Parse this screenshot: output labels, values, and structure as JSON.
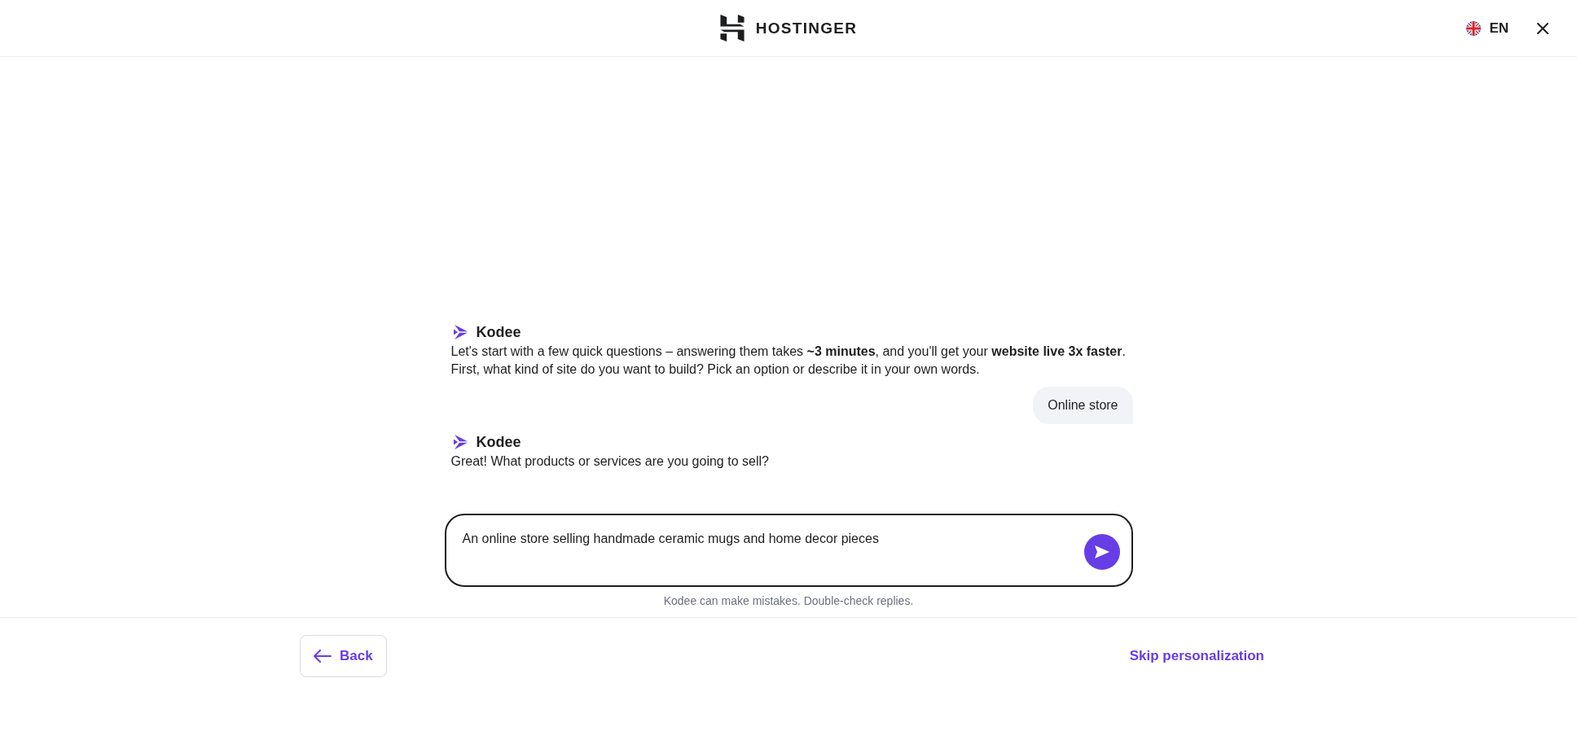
{
  "header": {
    "logo_text": "HOSTINGER",
    "language": "EN"
  },
  "messages": [
    {
      "kind": "assistant",
      "sender": "Kodee",
      "lines": [
        "Let's start with a few quick questions – answering them takes **~3 minutes**, and you'll get your **website live 3x faster**.",
        "First, what kind of site do you want to build? Pick an option or describe it in your own words."
      ]
    },
    {
      "kind": "user",
      "text": "Online store"
    },
    {
      "kind": "assistant",
      "sender": "Kodee",
      "lines": [
        "Great! What products or services are you going to sell?"
      ]
    }
  ],
  "composer": {
    "value": "An online store selling handmade ceramic mugs and home decor pieces"
  },
  "disclaimer": "Kodee can make mistakes. Double-check replies.",
  "footer": {
    "back": "Back",
    "skip": "Skip personalization"
  }
}
